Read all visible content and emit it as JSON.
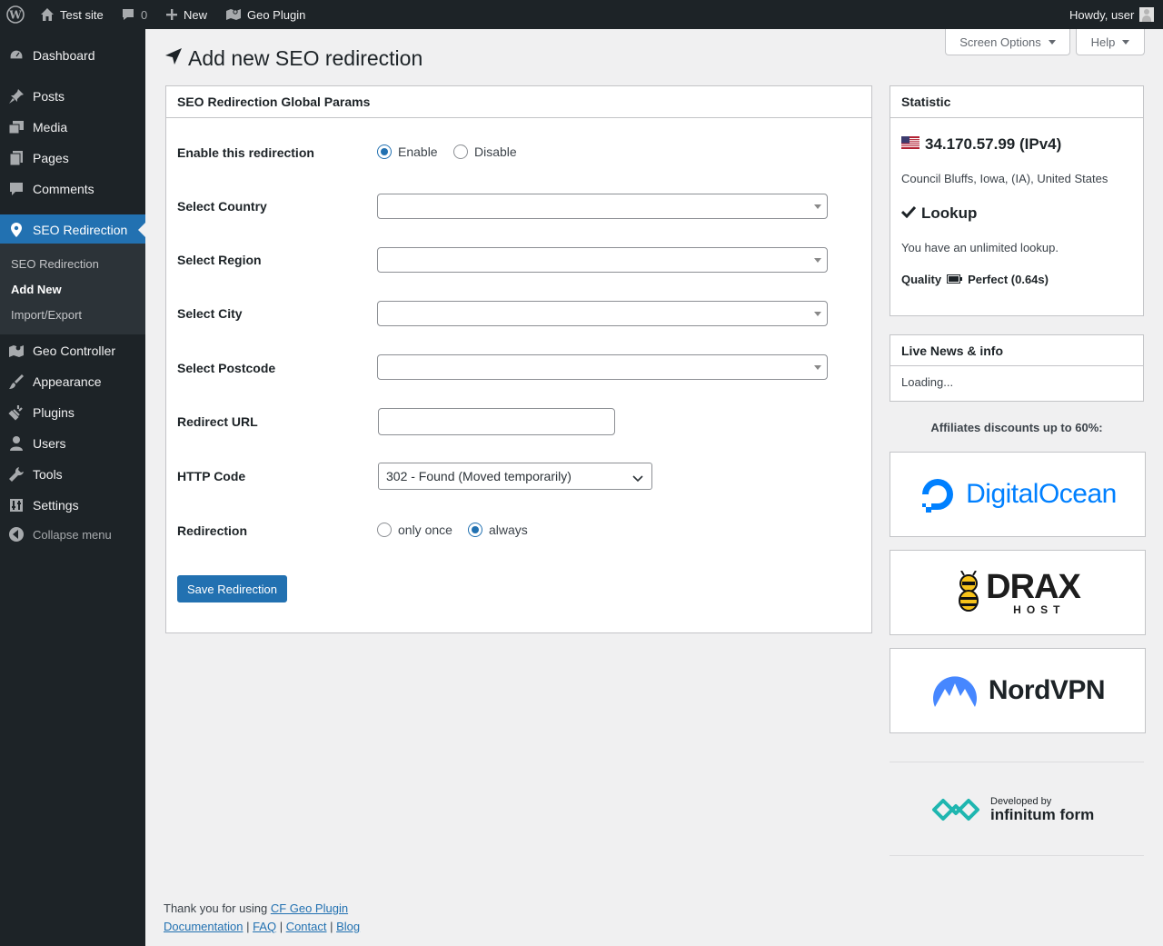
{
  "adminbar": {
    "site_name": "Test site",
    "comments_count": "0",
    "new_label": "New",
    "plugin_label": "Geo Plugin",
    "howdy": "Howdy, user"
  },
  "sidebar": {
    "items": [
      {
        "label": "Dashboard",
        "icon": "dashboard-icon"
      },
      {
        "label": "Posts",
        "icon": "pin-icon"
      },
      {
        "label": "Media",
        "icon": "media-icon"
      },
      {
        "label": "Pages",
        "icon": "pages-icon"
      },
      {
        "label": "Comments",
        "icon": "comment-icon"
      },
      {
        "label": "SEO Redirection",
        "icon": "location-pin-icon"
      },
      {
        "label": "Geo Controller",
        "icon": "map-icon"
      },
      {
        "label": "Appearance",
        "icon": "brush-icon"
      },
      {
        "label": "Plugins",
        "icon": "plug-icon"
      },
      {
        "label": "Users",
        "icon": "user-icon"
      },
      {
        "label": "Tools",
        "icon": "wrench-icon"
      },
      {
        "label": "Settings",
        "icon": "settings-icon"
      }
    ],
    "submenu": [
      "SEO Redirection",
      "Add New",
      "Import/Export"
    ],
    "collapse_label": "Collapse menu"
  },
  "top_buttons": {
    "screen_options": "Screen Options",
    "help": "Help"
  },
  "page_title": "Add new SEO redirection",
  "form": {
    "panel_title": "SEO Redirection Global Params",
    "enable_label": "Enable this redirection",
    "enable_option": "Enable",
    "disable_option": "Disable",
    "country_label": "Select Country",
    "region_label": "Select Region",
    "city_label": "Select City",
    "postcode_label": "Select Postcode",
    "redirect_url_label": "Redirect URL",
    "redirect_url_value": "",
    "http_code_label": "HTTP Code",
    "http_code_value": "302 - Found (Moved temporarily)",
    "redirection_label": "Redirection",
    "only_once_option": "only once",
    "always_option": "always",
    "save_button": "Save Redirection"
  },
  "statistic": {
    "title": "Statistic",
    "ip": "34.170.57.99 (IPv4)",
    "location": "Council Bluffs, Iowa, (IA), United States",
    "lookup_title": "Lookup",
    "lookup_text": "You have an unlimited lookup.",
    "quality_label": "Quality",
    "quality_value": "Perfect (0.64s)"
  },
  "news": {
    "title": "Live News & info",
    "loading": "Loading..."
  },
  "affiliates": {
    "heading": "Affiliates discounts up to 60%:",
    "logos": [
      "DigitalOcean",
      "DRAX",
      "HOST",
      "NordVPN",
      "Developed by",
      "infinitum form"
    ]
  },
  "footer": {
    "thanks": "Thank you for using",
    "plugin_link": "CF Geo Plugin",
    "links": [
      "Documentation",
      "FAQ",
      "Contact",
      "Blog"
    ]
  },
  "colors": {
    "accent": "#2271b1",
    "adminbar": "#1d2327",
    "background": "#f0f0f1"
  }
}
